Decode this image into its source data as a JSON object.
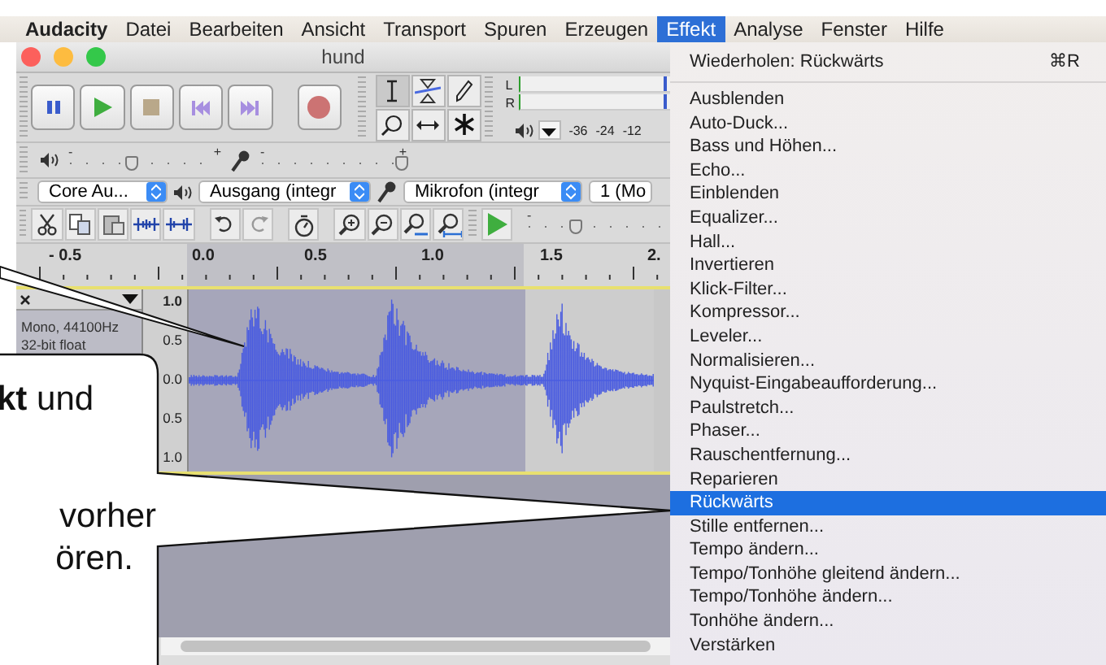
{
  "menubar": {
    "items": [
      {
        "label": "Audacity",
        "selected": false
      },
      {
        "label": "Datei",
        "selected": false
      },
      {
        "label": "Bearbeiten",
        "selected": false
      },
      {
        "label": "Ansicht",
        "selected": false
      },
      {
        "label": "Transport",
        "selected": false
      },
      {
        "label": "Spuren",
        "selected": false
      },
      {
        "label": "Erzeugen",
        "selected": false
      },
      {
        "label": "Effekt",
        "selected": true
      },
      {
        "label": "Analyse",
        "selected": false
      },
      {
        "label": "Fenster",
        "selected": false
      },
      {
        "label": "Hilfe",
        "selected": false
      }
    ]
  },
  "window": {
    "title": "hund"
  },
  "meter": {
    "channels": [
      "L",
      "R"
    ],
    "ticks": [
      "-36",
      "-24",
      "-12"
    ]
  },
  "mixer": {
    "sliders": [
      {
        "kind": "playback",
        "min_label": "-",
        "max_label": "+",
        "level": 0.42
      },
      {
        "kind": "recording",
        "min_label": "-",
        "max_label": "+",
        "level": 1
      }
    ]
  },
  "devices": [
    "Core Au...",
    "Ausgang (integr",
    "Mikrofon (integr",
    "1 (Mo"
  ],
  "play_at_speed": {
    "min_label": "-",
    "level": 0.35
  },
  "ruler": {
    "ticks": [
      "- 0.5",
      "0.0",
      "0.5",
      "1.0",
      "1.5",
      "2."
    ]
  },
  "track": {
    "info": [
      "Mono, 44100Hz",
      "32-bit float"
    ],
    "scale": [
      "1.0",
      "0.5",
      "0.0",
      "0.5",
      "1.0"
    ]
  },
  "effect_menu": {
    "repeat": {
      "label": "Wiederholen: Rückwärts",
      "shortcut": "⌘R"
    },
    "items": [
      {
        "label": "Ausblenden",
        "selected": false
      },
      {
        "label": "Auto-Duck...",
        "selected": false
      },
      {
        "label": "Bass und Höhen...",
        "selected": false
      },
      {
        "label": "Echo...",
        "selected": false
      },
      {
        "label": "Einblenden",
        "selected": false
      },
      {
        "label": "Equalizer...",
        "selected": false
      },
      {
        "label": "Hall...",
        "selected": false
      },
      {
        "label": "Invertieren",
        "selected": false
      },
      {
        "label": "Klick-Filter...",
        "selected": false
      },
      {
        "label": "Kompressor...",
        "selected": false
      },
      {
        "label": "Leveler...",
        "selected": false
      },
      {
        "label": "Normalisieren...",
        "selected": false
      },
      {
        "label": "Nyquist-Eingabeaufforderung...",
        "selected": false
      },
      {
        "label": "Paulstretch...",
        "selected": false
      },
      {
        "label": "Phaser...",
        "selected": false
      },
      {
        "label": "Rauschentfernung...",
        "selected": false
      },
      {
        "label": "Reparieren",
        "selected": false
      },
      {
        "label": "Rückwärts",
        "selected": true
      },
      {
        "label": "Stille entfernen...",
        "selected": false
      },
      {
        "label": "Tempo ändern...",
        "selected": false
      },
      {
        "label": "Tempo/Tonhöhe gleitend ändern...",
        "selected": false
      },
      {
        "label": "Tempo/Tonhöhe ändern...",
        "selected": false
      },
      {
        "label": "Tonhöhe ändern...",
        "selected": false
      },
      {
        "label": "Verstärken",
        "selected": false
      }
    ]
  },
  "callouts": [
    {
      "lines": [
        "**kt** und"
      ]
    },
    {
      "lines": [
        "vorher",
        "ören."
      ]
    }
  ]
}
